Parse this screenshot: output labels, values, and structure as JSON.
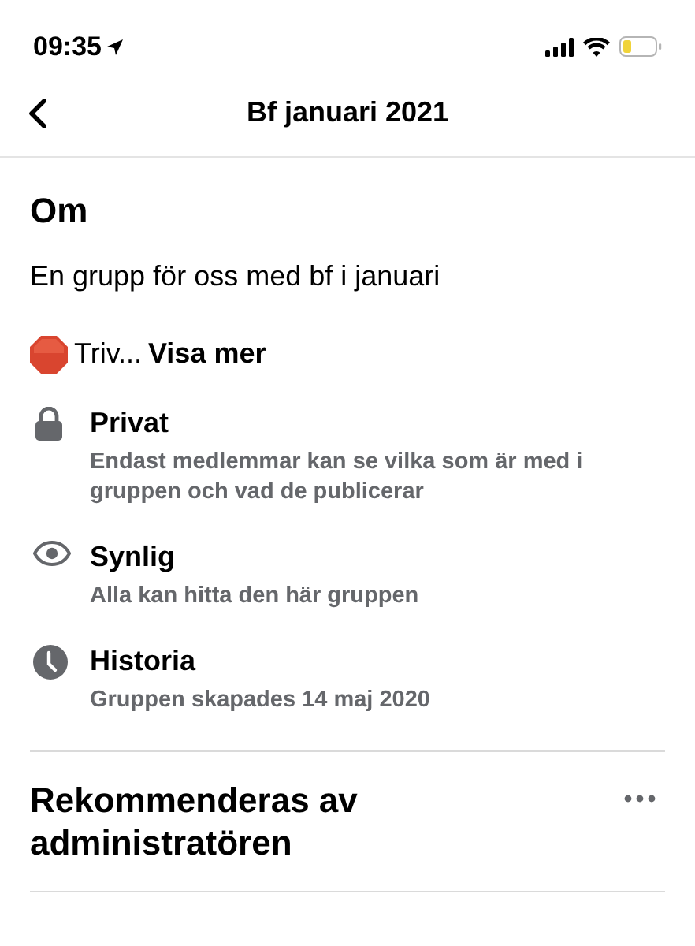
{
  "status_bar": {
    "time": "09:35"
  },
  "nav": {
    "title": "Bf januari 2021"
  },
  "about": {
    "heading": "Om",
    "description": "En grupp för oss med bf i januari",
    "rules_preview": "Triv...",
    "more_link": "Visa mer"
  },
  "details": [
    {
      "kind": "lock",
      "title": "Privat",
      "text": "Endast medlemmar kan se vilka som är med i gruppen och vad de publicerar"
    },
    {
      "kind": "eye",
      "title": "Synlig",
      "text": "Alla kan hitta den här gruppen"
    },
    {
      "kind": "clock",
      "title": "Historia",
      "text": "Gruppen skapades 14 maj 2020"
    }
  ],
  "recommended": {
    "heading": "Rekommenderas av administratören"
  }
}
